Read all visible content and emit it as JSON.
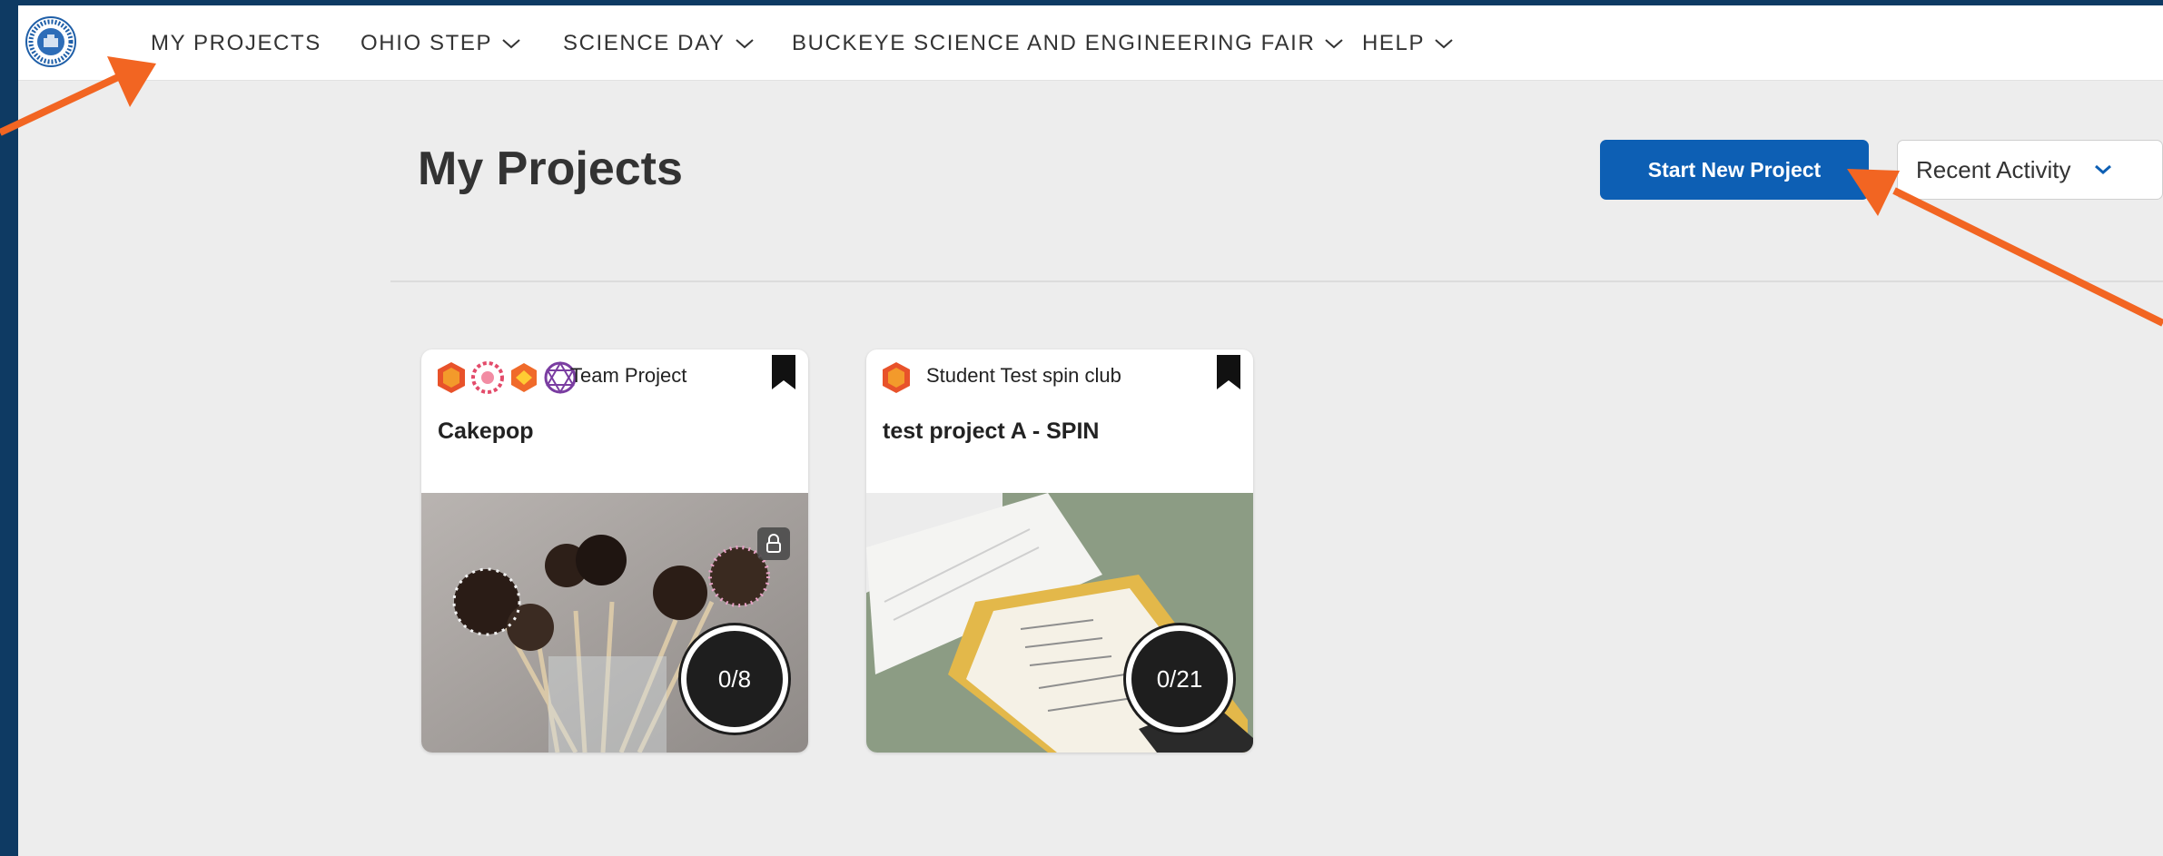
{
  "nav": {
    "items": [
      {
        "label": "MY PROJECTS",
        "dropdown": false
      },
      {
        "label": "OHIO STEP",
        "dropdown": true
      },
      {
        "label": "SCIENCE DAY",
        "dropdown": true
      },
      {
        "label": "BUCKEYE SCIENCE AND ENGINEERING FAIR",
        "dropdown": true
      },
      {
        "label": "HELP",
        "dropdown": true
      }
    ]
  },
  "header": {
    "title": "My Projects",
    "start_button": "Start New Project",
    "sort_selected": "Recent Activity"
  },
  "projects": [
    {
      "type": "Team Project",
      "title": "Cakepop",
      "progress": "0/8",
      "locked": true,
      "photo": "cake-pops"
    },
    {
      "type": "Student Test spin club",
      "title": "test project A - SPIN",
      "progress": "0/21",
      "locked": false,
      "photo": "lab-notes-tray"
    }
  ],
  "colors": {
    "frame": "#0e3a63",
    "primary_button": "#0d5fb4",
    "annotation_arrow": "#f26522",
    "page_bg": "#ededed"
  },
  "icons": [
    "logo-icon",
    "chevron-down-icon",
    "bookmark-icon",
    "lock-icon",
    "club-badge-icon"
  ]
}
